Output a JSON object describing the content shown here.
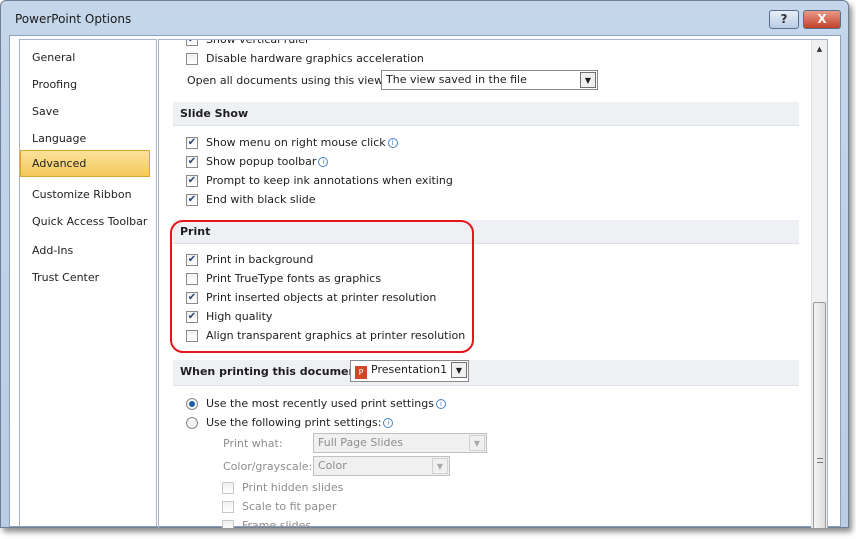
{
  "window": {
    "title": "PowerPoint Options",
    "help": "?",
    "close": "X"
  },
  "sidebar": {
    "items": [
      {
        "label": "General"
      },
      {
        "label": "Proofing"
      },
      {
        "label": "Save"
      },
      {
        "label": "Language"
      },
      {
        "label": "Advanced",
        "active": true
      },
      {
        "label": "Customize Ribbon"
      },
      {
        "label": "Quick Access Toolbar"
      },
      {
        "label": "Add-Ins"
      },
      {
        "label": "Trust Center"
      }
    ]
  },
  "display": {
    "show_vertical_ruler": "Show vertical ruler",
    "disable_hw": "Disable hardware graphics acceleration",
    "open_docs_label": "Open all documents using this view",
    "open_docs_value": "The view saved in the file"
  },
  "slideshow": {
    "header": "Slide Show",
    "items": [
      {
        "label": "Show menu on right mouse click",
        "checked": true,
        "info": true
      },
      {
        "label": "Show popup toolbar",
        "checked": true,
        "info": true
      },
      {
        "label": "Prompt to keep ink annotations when exiting",
        "checked": true
      },
      {
        "label": "End with black slide",
        "checked": true
      }
    ]
  },
  "print": {
    "header": "Print",
    "items": [
      {
        "label": "Print in background",
        "checked": true
      },
      {
        "label": "Print TrueType fonts as graphics",
        "checked": false
      },
      {
        "label": "Print inserted objects at printer resolution",
        "checked": true
      },
      {
        "label": "High quality",
        "checked": true
      },
      {
        "label": "Align transparent graphics at printer resolution",
        "checked": false
      }
    ]
  },
  "when_printing": {
    "header": "When printing this document:",
    "document": "Presentation1",
    "radio_recent": "Use the most recently used print settings",
    "radio_following": "Use the following print settings:",
    "selected": "recent",
    "print_what_label": "Print what:",
    "print_what_value": "Full Page Slides",
    "color_label": "Color/grayscale:",
    "color_value": "Color",
    "print_hidden": "Print hidden slides",
    "scale_fit": "Scale to fit paper",
    "frame_slides": "Frame slides"
  },
  "colors": {
    "highlight": "#e8141c",
    "active_item": "#f5c85a"
  }
}
